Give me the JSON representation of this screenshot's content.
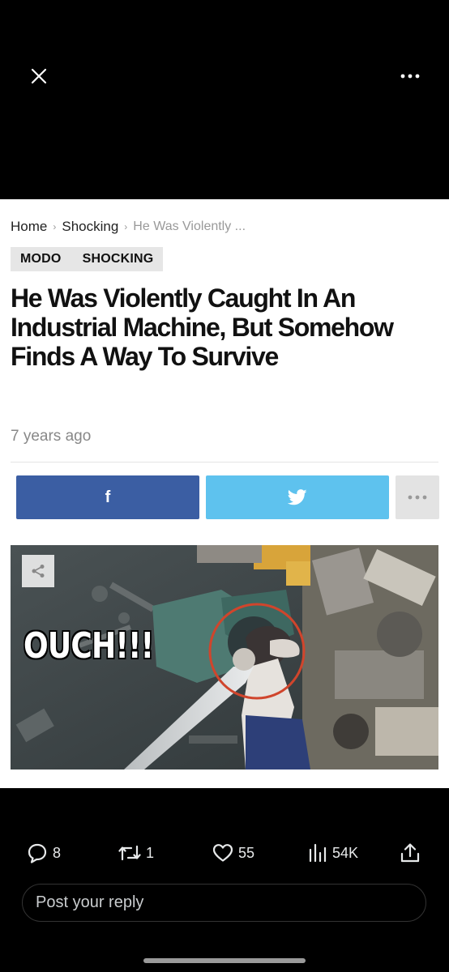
{
  "breadcrumb": {
    "home": "Home",
    "category": "Shocking",
    "current": "He Was Violently ..."
  },
  "tags": [
    "MODO",
    "SHOCKING"
  ],
  "article": {
    "headline": "He Was Violently Caught In An Industrial Machine, But Somehow Finds A Way To Survive",
    "age": "7 years ago",
    "image_caption": "OUCH!!!"
  },
  "share": {
    "facebook_icon": "f",
    "twitter_icon": "twitter-bird-icon",
    "more_icon": "more-icon"
  },
  "post_actions": {
    "replies": "8",
    "reposts": "1",
    "likes": "55",
    "views": "54K"
  },
  "reply": {
    "placeholder": "Post your reply"
  },
  "colors": {
    "facebook": "#3b5ea3",
    "twitter": "#5ec2ee",
    "highlight_circle": "#d0452c"
  }
}
